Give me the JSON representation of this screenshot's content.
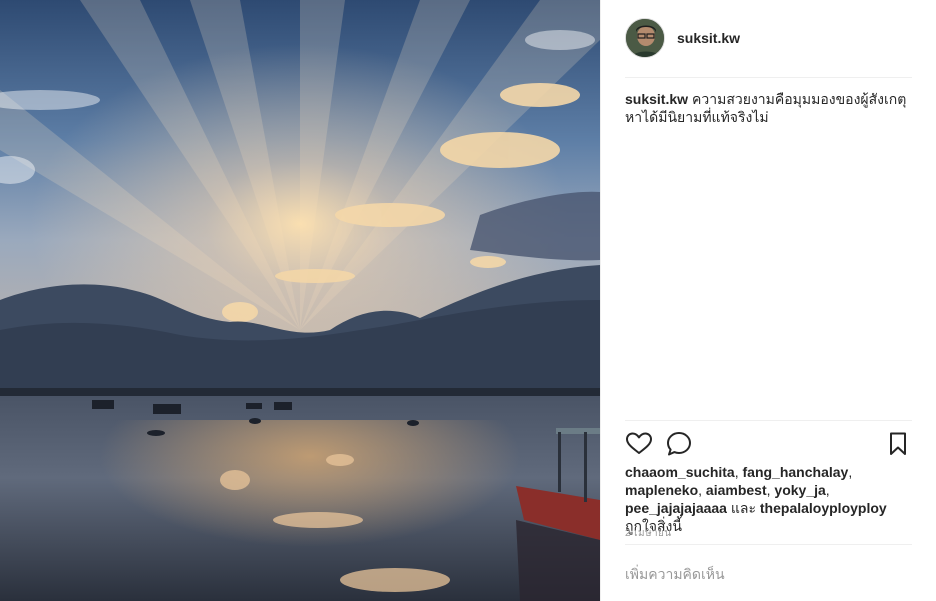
{
  "post": {
    "username": "suksit.kw",
    "caption_user": "suksit.kw",
    "caption_text": "ความสวยงามคือมุมมองของผู้สังเกตุ หาได้มีนิยามที่แท้จริงไม่",
    "likes": {
      "likers": [
        "chaaom_suchita",
        "fang_hanchalay",
        "mapleneko",
        "aiambest",
        "yoky_ja",
        "pee_jajajajaaaa",
        "thepalaloyployploy"
      ],
      "separator": ", ",
      "conjunction": "และ",
      "suffix": "ถูกใจสิ่งนี้"
    },
    "date": "2 เมษายน",
    "comment_placeholder": "เพิ่มความคิดเห็น"
  },
  "icons": {
    "like": "heart-icon",
    "comment": "comment-bubble-icon",
    "save": "bookmark-icon"
  },
  "colors": {
    "text": "#262626",
    "muted": "#999999",
    "divider": "#efefef"
  }
}
